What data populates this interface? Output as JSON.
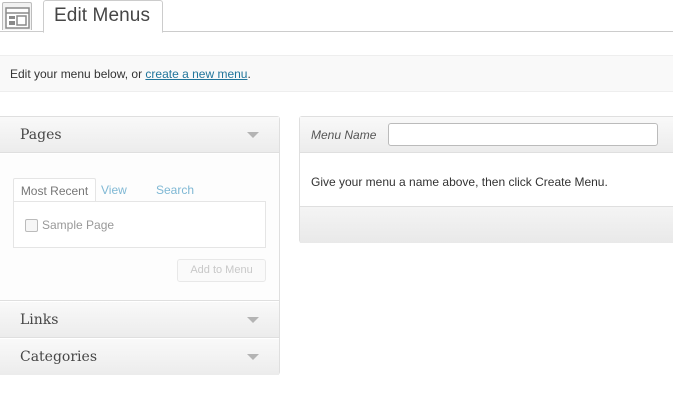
{
  "header": {
    "title": "Edit Menus",
    "icon": "menus-icon"
  },
  "intro": {
    "text_before": "Edit your menu below, or ",
    "link_label": "create a new menu",
    "text_after": "."
  },
  "accordion": {
    "pages": {
      "title": "Pages",
      "tabs": [
        "Most Recent",
        "View All",
        "Search"
      ],
      "active_tab": "Most Recent",
      "items": [
        {
          "label": "Sample Page",
          "checked": false
        }
      ],
      "add_button_label": "Add to Menu"
    },
    "links": {
      "title": "Links"
    },
    "categories": {
      "title": "Categories"
    }
  },
  "menu_panel": {
    "name_label": "Menu Name",
    "name_value": "",
    "name_placeholder": "",
    "instructions": "Give your menu a name above, then click Create Menu."
  },
  "colors": {
    "link": "#21759b",
    "tab_link": "#7fb8d4",
    "border": "#dfdfdf",
    "text": "#333333"
  }
}
